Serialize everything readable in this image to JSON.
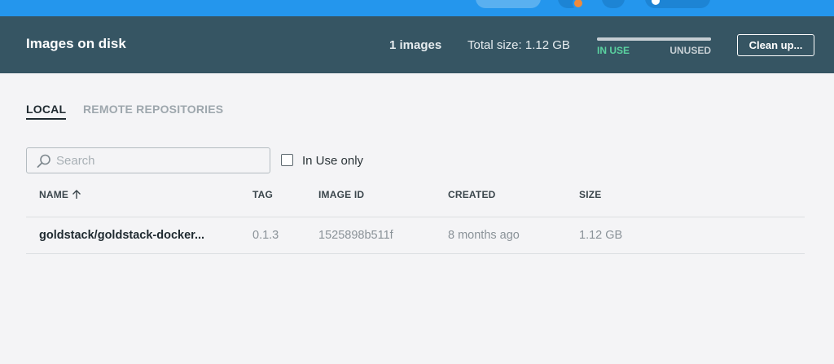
{
  "header": {
    "title": "Images on disk",
    "image_count": "1 images",
    "total_size": "Total size: 1.12 GB",
    "usage_in_use_label": "IN USE",
    "usage_unused_label": "UNUSED",
    "usage_in_use_fraction": 1.0,
    "cleanup_label": "Clean up..."
  },
  "tabs": [
    {
      "label": "LOCAL",
      "active": true
    },
    {
      "label": "REMOTE REPOSITORIES",
      "active": false
    }
  ],
  "search": {
    "placeholder": "Search",
    "value": ""
  },
  "filter": {
    "in_use_only_label": "In Use only",
    "checked": false
  },
  "table": {
    "columns": [
      "NAME",
      "TAG",
      "IMAGE ID",
      "CREATED",
      "SIZE"
    ],
    "sort_column": "NAME",
    "sort_direction": "ascending",
    "rows": [
      {
        "name": "goldstack/goldstack-docker...",
        "tag": "0.1.3",
        "image_id": "1525898b511f",
        "created": "8 months ago",
        "size": "1.12 GB"
      }
    ]
  },
  "icons": {
    "search": "search-icon",
    "sort": "arrow-up-icon",
    "notification": "bell-icon",
    "settings": "gear-icon",
    "account": "user-icon"
  },
  "colors": {
    "topbar": "#2496ed",
    "header": "#365563",
    "in_use": "#5ad2a0",
    "unused": "#c5ced3",
    "badge": "#ef8a3c"
  }
}
